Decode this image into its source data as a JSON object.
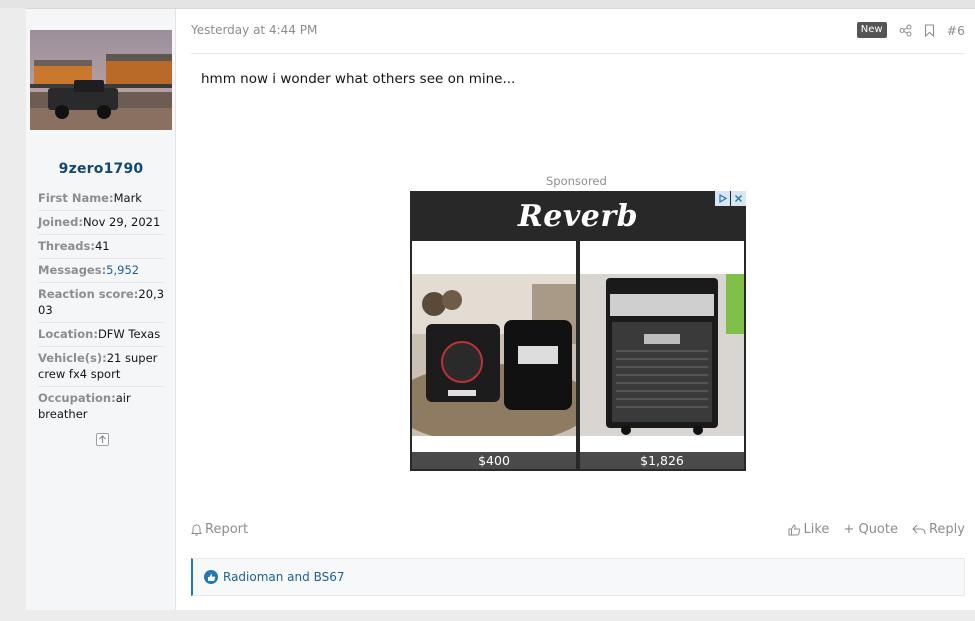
{
  "colors": {
    "accent": "#2577b1",
    "username": "#13496e",
    "badge_bg": "#555555",
    "ad_bg": "#282828"
  },
  "user": {
    "avatar_icon": "avatar-truck-train-photo",
    "username": "9zero1790",
    "stats": [
      {
        "key": "First Name:",
        "value": "Mark"
      },
      {
        "key": "Joined:",
        "value": "Nov 29, 2021"
      },
      {
        "key": "Threads:",
        "value": "41"
      },
      {
        "key": "Messages:",
        "value": "5,952"
      },
      {
        "key": "Reaction score:",
        "value": "20,303"
      },
      {
        "key": "Location:",
        "value": "DFW Texas"
      },
      {
        "key": "Vehicle(s):",
        "value": "21 super crew fx4 sport"
      },
      {
        "key": "Occupation:",
        "value": "air breather"
      }
    ]
  },
  "post": {
    "timestamp": "Yesterday at 4:44 PM",
    "badge": "New",
    "number": "#6",
    "message": "hmm now i wonder what others see on mine..."
  },
  "ad": {
    "label": "Sponsored",
    "brand": "Reverb",
    "items": [
      {
        "price": "$400",
        "image_icon": "bass-amp-with-bag-photo"
      },
      {
        "price": "$1,826",
        "image_icon": "mesa-cabinet-photo"
      }
    ]
  },
  "actions": {
    "report": "Report",
    "like": "Like",
    "quote": "+ Quote",
    "reply": "Reply"
  },
  "reactions": {
    "text": "Radioman and BS67"
  }
}
